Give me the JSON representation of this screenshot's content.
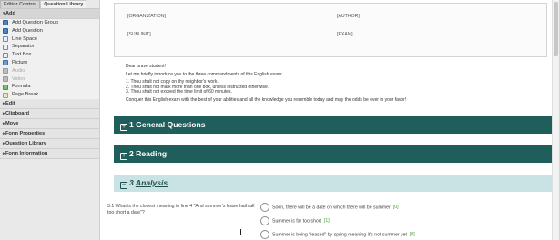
{
  "sidebar": {
    "tabs": [
      "Editor Control",
      "Question Library"
    ],
    "add_section": "Add",
    "add_items": [
      {
        "label": "Add Question Group",
        "icon": "group-icon",
        "disabled": false
      },
      {
        "label": "Add Question",
        "icon": "question-icon",
        "disabled": false
      },
      {
        "label": "Line Space",
        "icon": "line-space-icon",
        "disabled": false
      },
      {
        "label": "Separator",
        "icon": "separator-icon",
        "disabled": false
      },
      {
        "label": "Text Box",
        "icon": "text-box-icon",
        "disabled": false
      },
      {
        "label": "Picture",
        "icon": "picture-icon",
        "disabled": false
      },
      {
        "label": "Audio",
        "icon": "audio-icon",
        "disabled": true
      },
      {
        "label": "Video",
        "icon": "video-icon",
        "disabled": true
      },
      {
        "label": "Formula",
        "icon": "formula-icon",
        "disabled": false
      },
      {
        "label": "Page Break",
        "icon": "page-break-icon",
        "disabled": false
      }
    ],
    "sections": [
      "Edit",
      "Clipboard",
      "Move",
      "Form Properties",
      "Question Library",
      "Form Information"
    ]
  },
  "meta": {
    "organization": "[ORGANIZATION]",
    "author": "[AUTHOR]",
    "subunit": "[SUBUNIT]",
    "exam": "[EXAM]"
  },
  "intro": {
    "greeting": "Dear brave student!",
    "lead": "Let me briefly introduce you to the three commandments of this English exam:",
    "rules": [
      "1. Thou shalt not copy on thy neighbor's work.",
      "2. Thou shalt not mark more than one box, unless instructed otherwise.",
      "3. Thou shalt not exceed the time limit of 60 minutes."
    ],
    "closing": "Conquer this English exam with the best of your abilities and all the knowledge you resemble today and may the odds be ever in your favor!"
  },
  "groups": [
    {
      "symbol": "+",
      "title": "1 General Questions"
    },
    {
      "symbol": "+",
      "title": "2 Reading"
    },
    {
      "symbol": "−",
      "number": "3",
      "title": "Analysis"
    }
  ],
  "question": {
    "text": "3.1 What is the closest meaning to line 4 \"And summer's lease hath all too short a date\"?",
    "options": [
      {
        "text": "Soon, there will be a date on which there will be summer",
        "score": "[0]"
      },
      {
        "text": "Summer is far too short",
        "score": "[1]"
      },
      {
        "text": "Summer is being \"leased\" by spring meaning it's not summer yet",
        "score": "[0]"
      }
    ]
  }
}
